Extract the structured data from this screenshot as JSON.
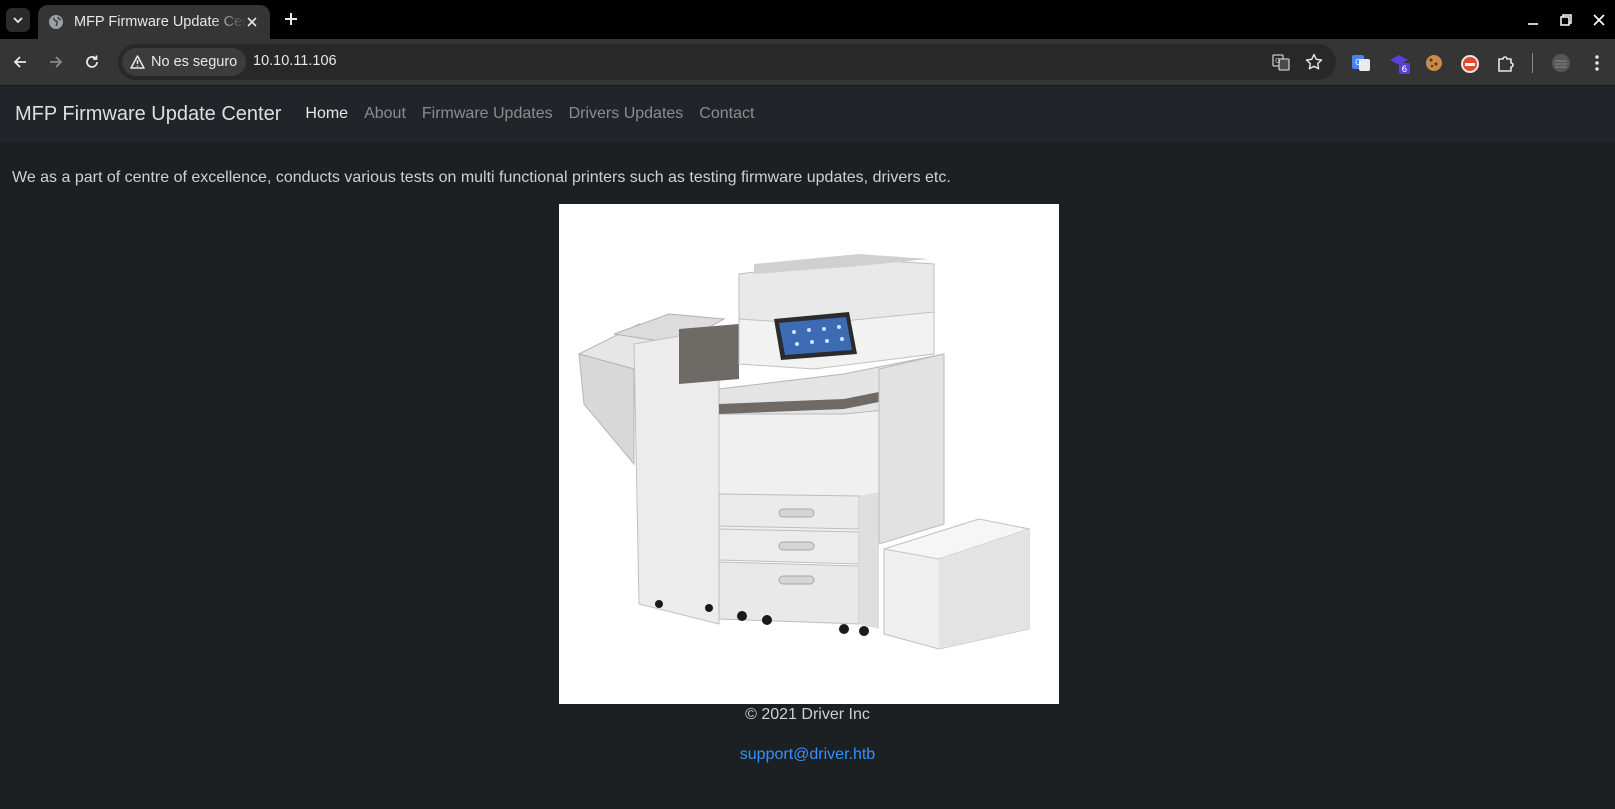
{
  "browser": {
    "tab_title": "MFP Firmware Update Center",
    "security_label": "No es seguro",
    "url": "10.10.11.106",
    "extension_badge": "6"
  },
  "navbar": {
    "brand": "MFP Firmware Update Center",
    "links": [
      "Home",
      "About",
      "Firmware Updates",
      "Drivers Updates",
      "Contact"
    ]
  },
  "main": {
    "intro": "We as a part of centre of excellence, conducts various tests on multi functional printers such as testing firmware updates, drivers etc."
  },
  "footer": {
    "copyright": "© 2021 Driver Inc",
    "email": "support@driver.htb"
  },
  "colors": {
    "page_bg": "#1d2022",
    "navbar_bg": "#212529",
    "link": "#3391ff"
  }
}
